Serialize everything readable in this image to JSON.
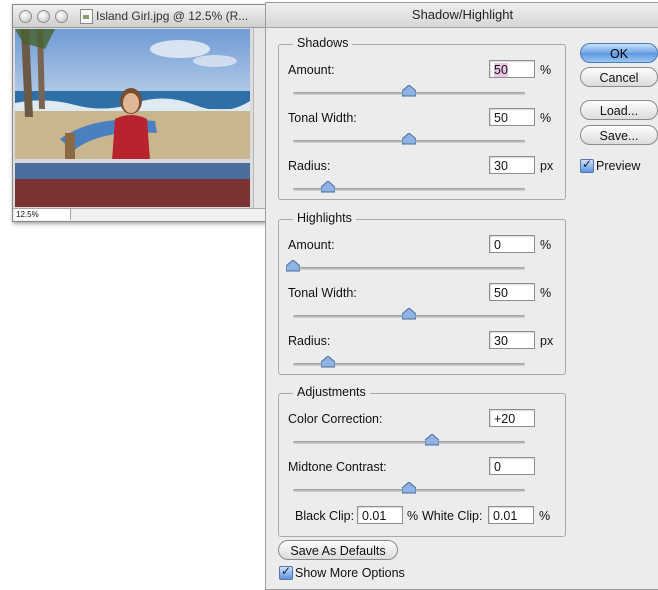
{
  "image_window": {
    "title": "Island Girl.jpg @ 12.5% (R...",
    "zoom": "12.5%"
  },
  "dialog": {
    "title": "Shadow/Highlight",
    "shadows": {
      "title": "Shadows",
      "amount_label": "Amount:",
      "amount": "50",
      "amount_unit": "%",
      "amount_pos": 0.5,
      "tonal_label": "Tonal Width:",
      "tonal": "50",
      "tonal_unit": "%",
      "tonal_pos": 0.5,
      "radius_label": "Radius:",
      "radius": "30",
      "radius_unit": "px",
      "radius_pos": 0.15
    },
    "highlights": {
      "title": "Highlights",
      "amount_label": "Amount:",
      "amount": "0",
      "amount_unit": "%",
      "amount_pos": 0.0,
      "tonal_label": "Tonal Width:",
      "tonal": "50",
      "tonal_unit": "%",
      "tonal_pos": 0.5,
      "radius_label": "Radius:",
      "radius": "30",
      "radius_unit": "px",
      "radius_pos": 0.15
    },
    "adjustments": {
      "title": "Adjustments",
      "color_label": "Color Correction:",
      "color": "+20",
      "color_pos": 0.6,
      "midtone_label": "Midtone Contrast:",
      "midtone": "0",
      "midtone_pos": 0.5,
      "black_clip_label": "Black Clip:",
      "black_clip": "0.01",
      "black_clip_unit": "%",
      "white_clip_label": "White Clip:",
      "white_clip": "0.01",
      "white_clip_unit": "%"
    },
    "buttons": {
      "ok": "OK",
      "cancel": "Cancel",
      "load": "Load...",
      "save": "Save...",
      "save_defaults": "Save As Defaults"
    },
    "preview_label": "Preview",
    "show_more_label": "Show More Options"
  }
}
